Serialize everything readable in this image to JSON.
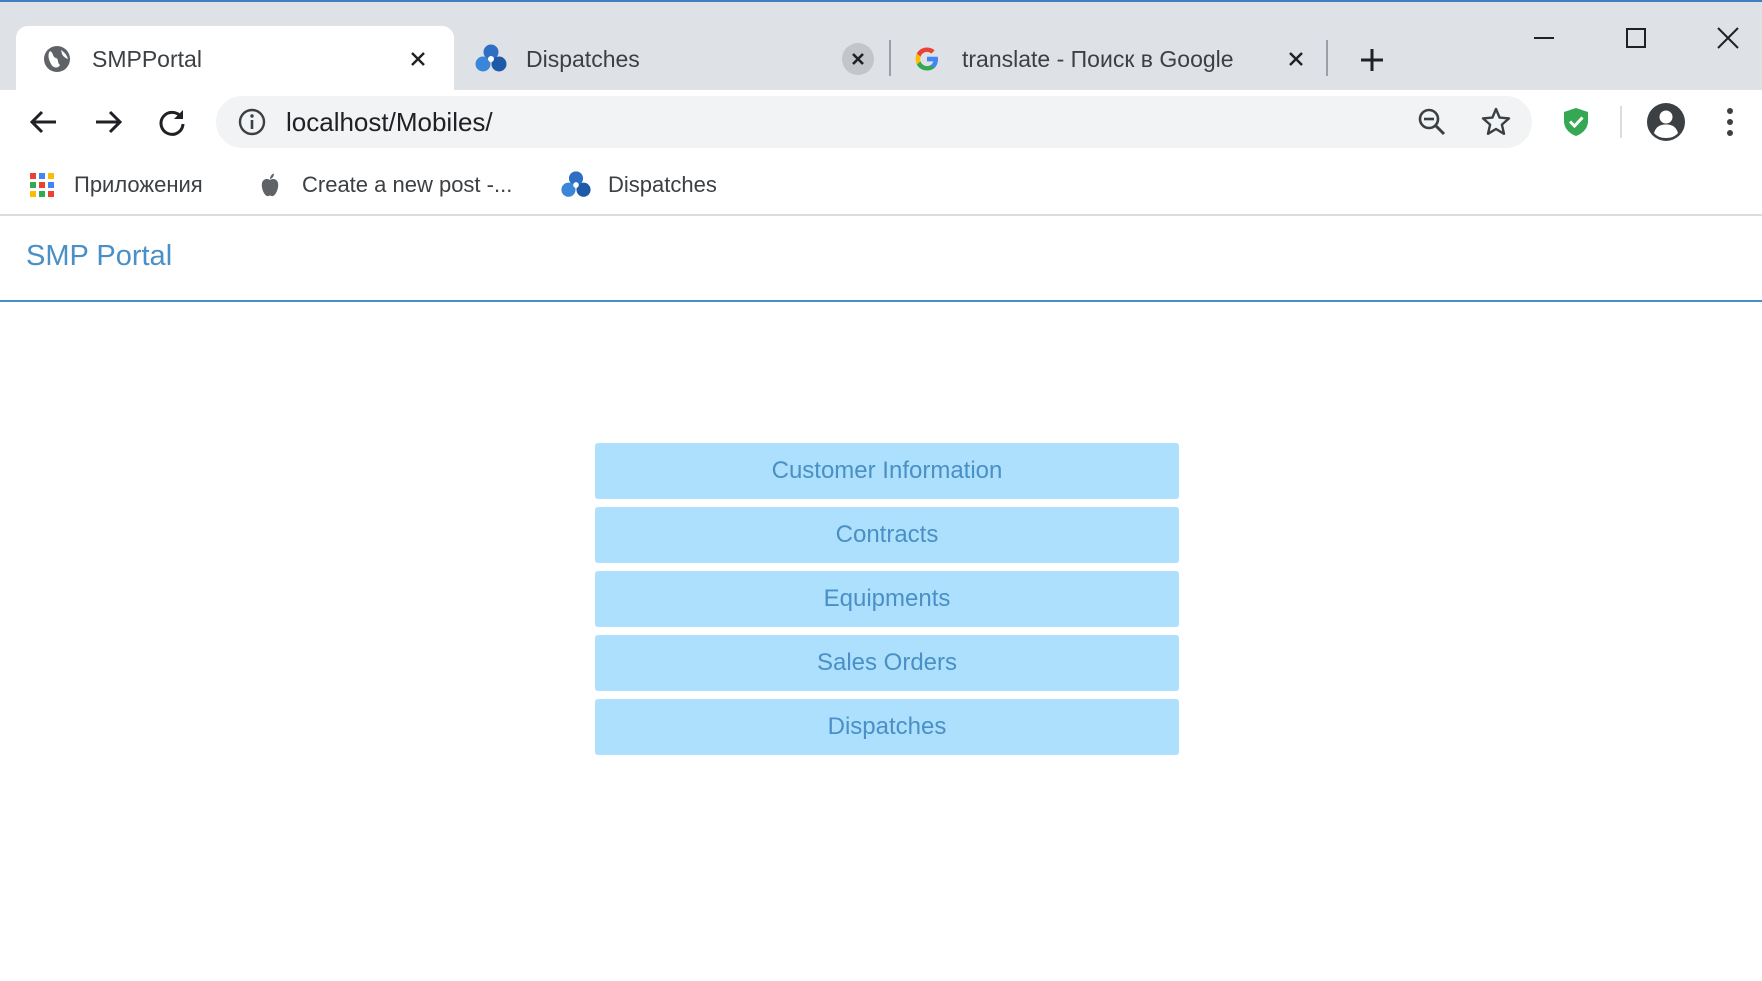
{
  "browser": {
    "tabs": [
      {
        "title": "SMPPortal",
        "icon": "globe-icon",
        "active": true
      },
      {
        "title": "Dispatches",
        "icon": "app-logo-icon",
        "active": false
      },
      {
        "title": "translate - Поиск в Google",
        "icon": "google-g-icon",
        "active": false
      }
    ],
    "address_bar": {
      "url": "localhost/Mobiles/"
    },
    "bookmarks": [
      {
        "label": "Приложения",
        "icon": "apps-grid-icon"
      },
      {
        "label": "Create a new post -...",
        "icon": "apple-icon"
      },
      {
        "label": "Dispatches",
        "icon": "app-logo-icon"
      }
    ]
  },
  "page": {
    "brand": "SMP Portal",
    "menu": [
      {
        "label": "Customer Information"
      },
      {
        "label": "Contracts"
      },
      {
        "label": "Equipments"
      },
      {
        "label": "Sales Orders"
      },
      {
        "label": "Dispatches"
      }
    ]
  },
  "colors": {
    "accent": "#4a8fc6",
    "button_bg": "#ade0fd",
    "chrome_bg": "#dee1e6",
    "shield_green": "#34a853"
  }
}
